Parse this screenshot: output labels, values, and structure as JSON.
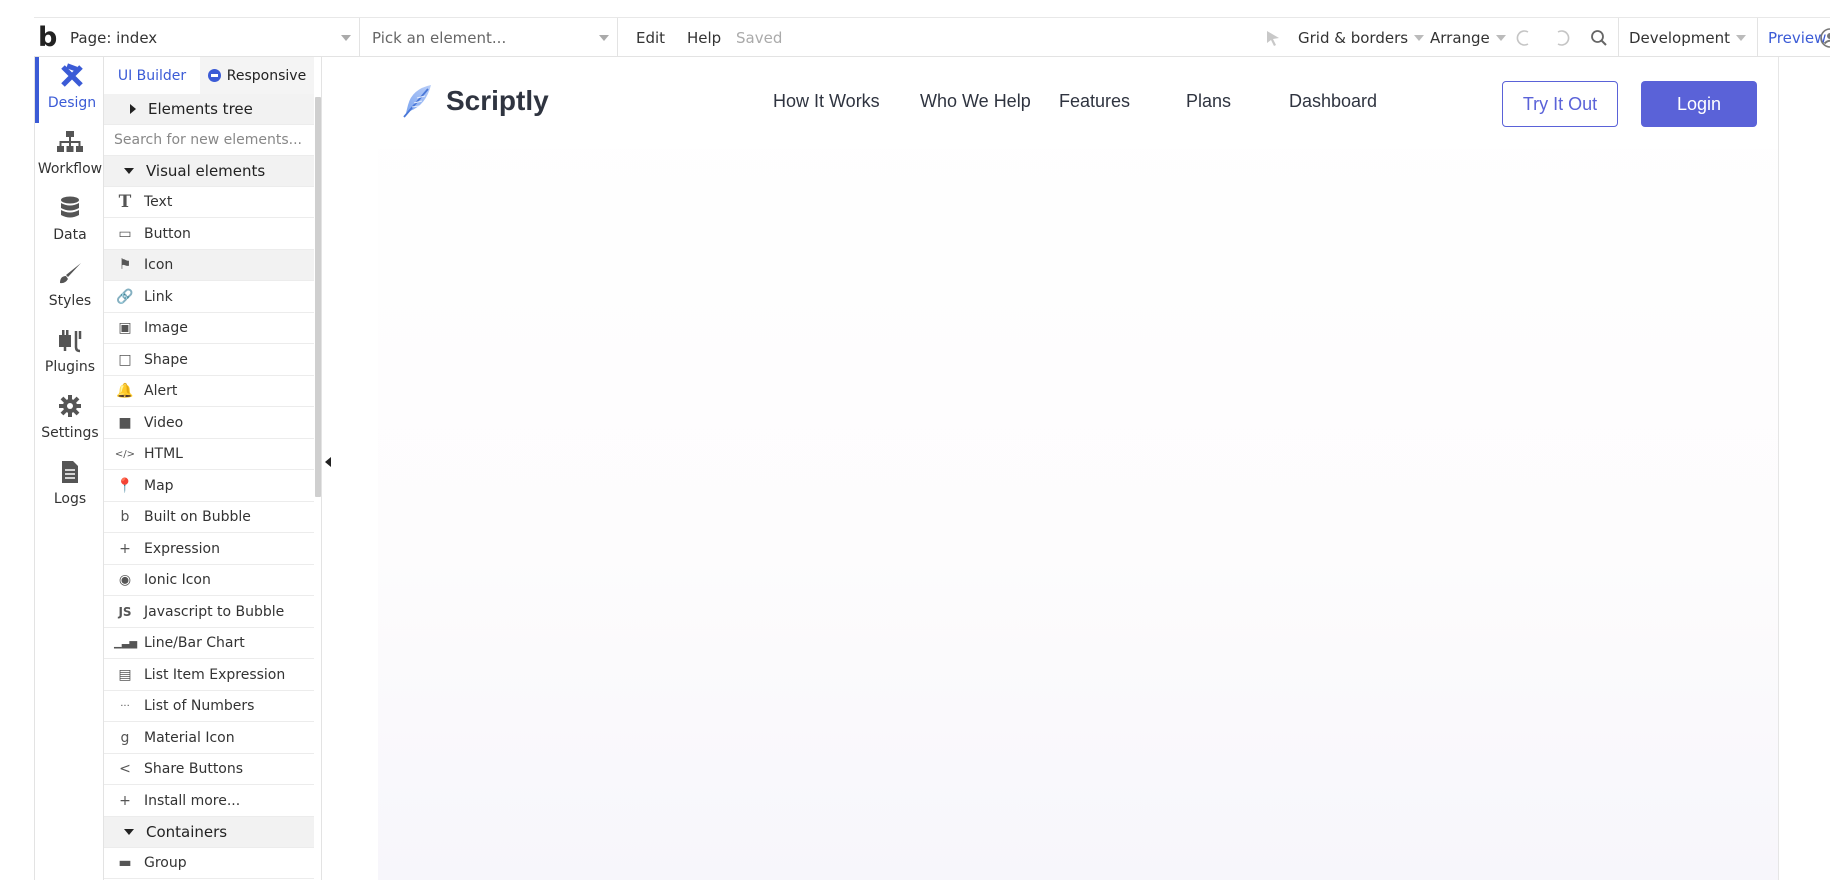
{
  "topbar": {
    "logo": "b",
    "page_label": "Page: index",
    "element_picker": "Pick an element...",
    "menu_edit": "Edit",
    "menu_help": "Help",
    "status": "Saved",
    "grid_borders": "Grid & borders",
    "arrange": "Arrange",
    "mode": "Development",
    "preview": "Preview"
  },
  "rail": [
    {
      "label": "Design",
      "icon": "design-icon"
    },
    {
      "label": "Workflow",
      "icon": "workflow-icon"
    },
    {
      "label": "Data",
      "icon": "database-icon"
    },
    {
      "label": "Styles",
      "icon": "brush-icon"
    },
    {
      "label": "Plugins",
      "icon": "plug-icon"
    },
    {
      "label": "Settings",
      "icon": "gear-icon"
    },
    {
      "label": "Logs",
      "icon": "document-icon"
    }
  ],
  "panel": {
    "tab_ui": "UI Builder",
    "tab_responsive": "Responsive",
    "elements_tree": "Elements tree",
    "search_placeholder": "Search for new elements...",
    "visual_header": "Visual elements",
    "containers_header": "Containers",
    "items": [
      {
        "label": "Text",
        "glyph": "T"
      },
      {
        "label": "Button",
        "glyph": "▭"
      },
      {
        "label": "Icon",
        "glyph": "⚑"
      },
      {
        "label": "Link",
        "glyph": "🔗"
      },
      {
        "label": "Image",
        "glyph": "▣"
      },
      {
        "label": "Shape",
        "glyph": "□"
      },
      {
        "label": "Alert",
        "glyph": "🔔"
      },
      {
        "label": "Video",
        "glyph": "■"
      },
      {
        "label": "HTML",
        "glyph": "</>"
      },
      {
        "label": "Map",
        "glyph": "📍"
      },
      {
        "label": "Built on Bubble",
        "glyph": "b"
      },
      {
        "label": "Expression",
        "glyph": "+"
      },
      {
        "label": "Ionic Icon",
        "glyph": "◉"
      },
      {
        "label": "Javascript to Bubble",
        "glyph": "JS"
      },
      {
        "label": "Line/Bar Chart",
        "glyph": "▁▃▅"
      },
      {
        "label": "List Item Expression",
        "glyph": "▤"
      },
      {
        "label": "List of Numbers",
        "glyph": "···"
      },
      {
        "label": "Material Icon",
        "glyph": "g"
      },
      {
        "label": "Share Buttons",
        "glyph": "<"
      },
      {
        "label": "Install more...",
        "glyph": "+"
      }
    ],
    "container_items": [
      {
        "label": "Group",
        "glyph": "▬"
      }
    ]
  },
  "site": {
    "brand": "Scriptly",
    "nav": [
      "How It Works",
      "Who We Help",
      "Features",
      "Plans",
      "Dashboard"
    ],
    "try_button": "Try It Out",
    "login_button": "Login"
  },
  "colors": {
    "accent": "#3b5bd6",
    "site_primary": "#5a62d8",
    "text_dark": "#2f3440"
  }
}
